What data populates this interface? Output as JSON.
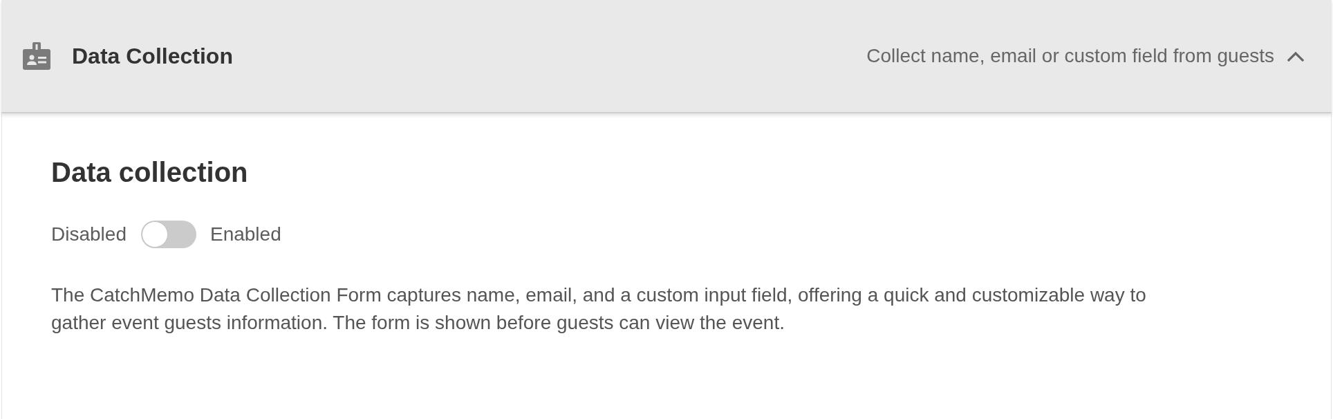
{
  "panel": {
    "title": "Data Collection",
    "summary": "Collect name, email or custom field from guests",
    "expanded": true
  },
  "section": {
    "heading": "Data collection",
    "toggle": {
      "off_label": "Disabled",
      "on_label": "Enabled",
      "on": false
    },
    "description": "The CatchMemo Data Collection Form captures name, email, and a custom input field, offering a quick and customizable way to gather event guests information. The form is shown before guests can view the event."
  }
}
